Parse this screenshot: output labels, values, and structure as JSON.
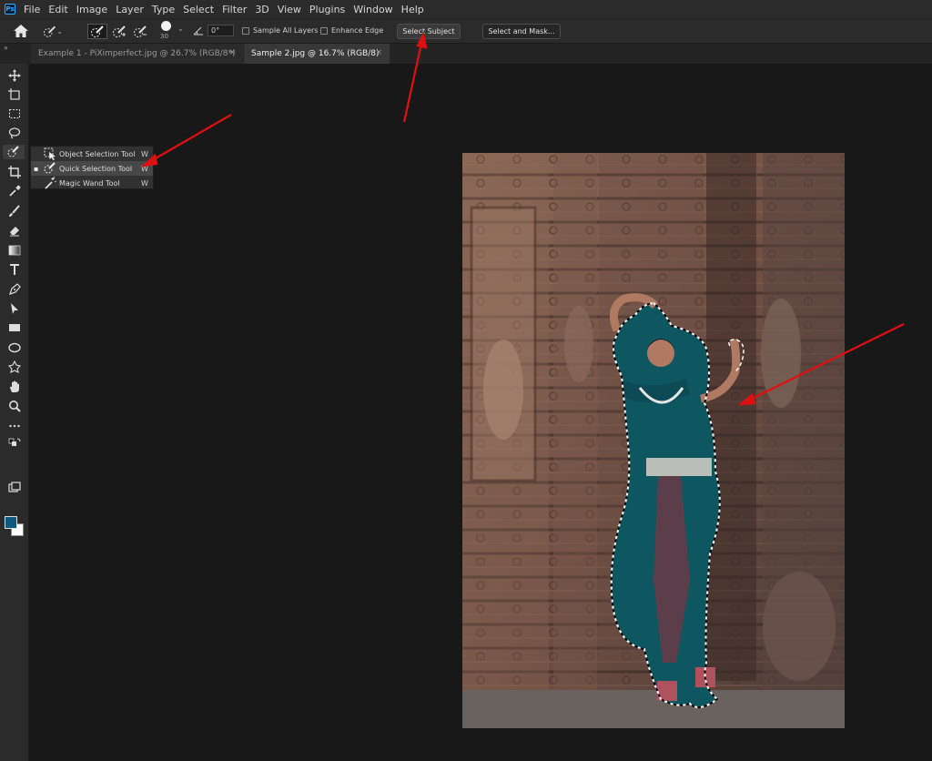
{
  "menubar": {
    "logo": "Ps",
    "items": [
      "File",
      "Edit",
      "Image",
      "Layer",
      "Type",
      "Select",
      "Filter",
      "3D",
      "View",
      "Plugins",
      "Window",
      "Help"
    ]
  },
  "options_bar": {
    "brush_size": "30",
    "angle": "0°",
    "sample_all_layers": "Sample All Layers",
    "enhance_edge": "Enhance Edge",
    "select_subject": "Select Subject",
    "select_and_mask": "Select and Mask..."
  },
  "tabs": [
    {
      "label": "Example 1 - PiXimperfect.jpg @ 26.7% (RGB/8*)",
      "close": "×"
    },
    {
      "label": "Sample 2.jpg @ 16.7% (RGB/8)",
      "close": "×"
    }
  ],
  "panel_collapse": "»",
  "tool_flyout": {
    "items": [
      {
        "label": "Object Selection Tool",
        "shortcut": "W",
        "icon": "object-selection-icon"
      },
      {
        "label": "Quick Selection Tool",
        "shortcut": "W",
        "icon": "quick-selection-icon",
        "active": true
      },
      {
        "label": "Magic Wand Tool",
        "shortcut": "W",
        "icon": "magic-wand-icon"
      }
    ]
  },
  "colors": {
    "foreground": "#0e5880",
    "background": "#ffffff",
    "annotation_arrow": "#e01010"
  }
}
